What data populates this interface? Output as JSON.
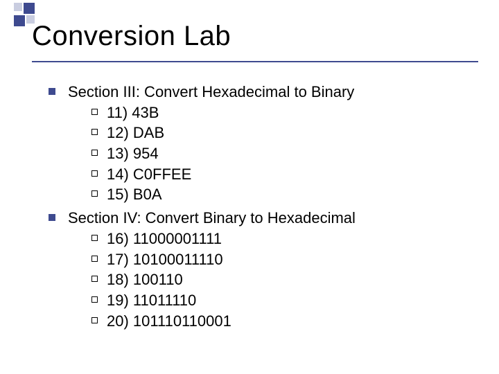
{
  "title": "Conversion Lab",
  "sections": [
    {
      "heading": "Section III: Convert Hexadecimal to Binary",
      "items": [
        "11) 43B",
        "12) DAB",
        "13) 954",
        "14) C0FFEE",
        "15) B0A"
      ]
    },
    {
      "heading": "Section IV: Convert Binary to Hexadecimal",
      "items": [
        "16) 11000001111",
        "17) 10100011110",
        "18) 100110",
        "19) 11011110",
        "20) 101110110001"
      ]
    }
  ]
}
